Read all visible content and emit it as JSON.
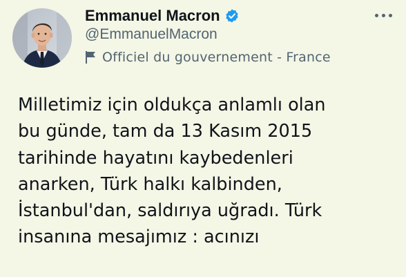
{
  "account": {
    "display_name": "Emmanuel Macron",
    "handle": "@EmmanuelMacron",
    "affiliation": "Officiel du gouvernement - France",
    "verified_icon": "verified-badge-icon",
    "affiliation_icon": "flag-icon",
    "avatar": "profile-photo"
  },
  "actions": {
    "more_icon": "more-options-icon"
  },
  "tweet": {
    "text": "Milletimiz için oldukça anlamlı olan\nbu günde, tam da 13 Kasım 2015\ntarihinde hayatını kaybedenleri\nanarken, Türk halkı kalbinden,\nİstanbul'dan, saldırıya uğradı. Türk\ninsanına mesajımız : acınızı"
  },
  "colors": {
    "background": "#f4f6e6",
    "text": "#0f1419",
    "secondary_text": "#536471",
    "verified_blue": "#1d9bf0"
  }
}
